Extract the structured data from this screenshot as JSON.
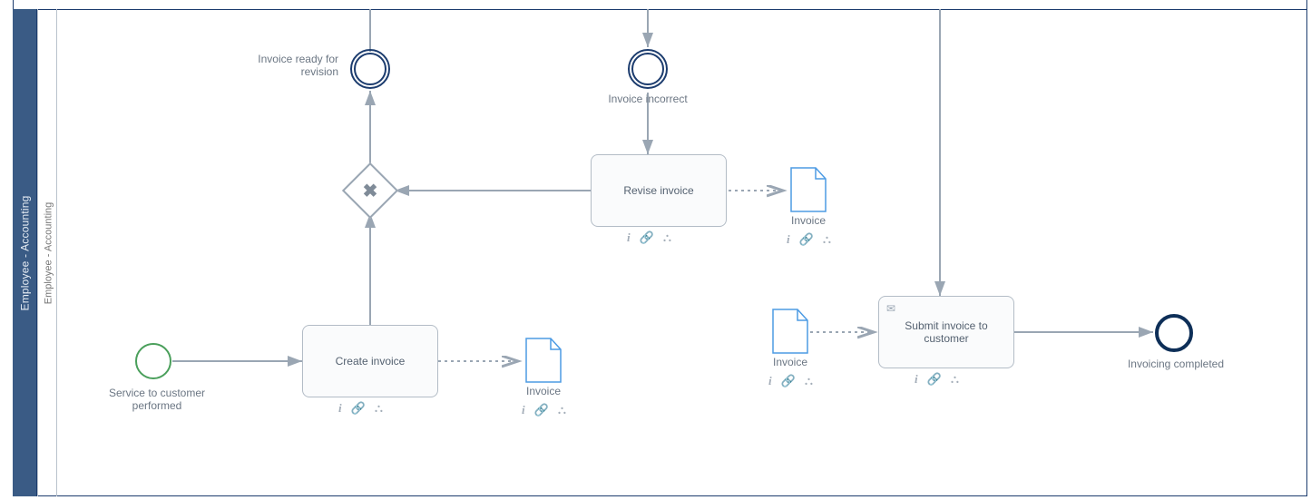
{
  "pool": {
    "label": "Employee - Accounting"
  },
  "lane": {
    "label": "Employee - Accounting"
  },
  "events": {
    "start": {
      "label": "Service to customer performed"
    },
    "readyForRevision": {
      "label": "Invoice ready for revision"
    },
    "invoiceIncorrect": {
      "label": "Invoice incorrect"
    },
    "end": {
      "label": "Invoicing completed"
    }
  },
  "tasks": {
    "create": {
      "label": "Create invoice"
    },
    "revise": {
      "label": "Revise invoice"
    },
    "submit": {
      "label": "Submit invoice to customer"
    }
  },
  "dataObjects": {
    "afterCreate": {
      "label": "Invoice"
    },
    "afterRevise": {
      "label": "Invoice"
    },
    "beforeSubmit": {
      "label": "Invoice"
    }
  },
  "icons": {
    "info": "i",
    "attach": "📎",
    "org": "👥"
  },
  "colors": {
    "poolFill": "#3a5b85",
    "border": "#1c3c6e",
    "taskBorder": "#b3bcc6",
    "startEvent": "#4a9f5b",
    "endEvent": "#0e2f58",
    "dataObject": "#4d9be4",
    "edge": "#9aa6b3"
  },
  "diagram_data": {
    "type": "BPMN",
    "pool": "Employee - Accounting",
    "lanes": [
      "Employee - Accounting"
    ],
    "elements": [
      {
        "id": "start",
        "type": "startEvent",
        "label": "Service to customer performed"
      },
      {
        "id": "create",
        "type": "task",
        "label": "Create invoice"
      },
      {
        "id": "do1",
        "type": "dataObject",
        "label": "Invoice"
      },
      {
        "id": "gw1",
        "type": "exclusiveGateway"
      },
      {
        "id": "ready",
        "type": "intermediateThrowEvent",
        "label": "Invoice ready for revision"
      },
      {
        "id": "incorrect",
        "type": "intermediateCatchEvent",
        "label": "Invoice incorrect"
      },
      {
        "id": "revise",
        "type": "task",
        "label": "Revise invoice"
      },
      {
        "id": "do2",
        "type": "dataObject",
        "label": "Invoice"
      },
      {
        "id": "do3",
        "type": "dataObject",
        "label": "Invoice"
      },
      {
        "id": "submit",
        "type": "sendTask",
        "label": "Submit invoice to customer"
      },
      {
        "id": "end",
        "type": "endEvent",
        "label": "Invoicing completed"
      }
    ],
    "sequenceFlows": [
      {
        "from": "start",
        "to": "create"
      },
      {
        "from": "create",
        "to": "gw1"
      },
      {
        "from": "gw1",
        "to": "ready"
      },
      {
        "from": "incorrect",
        "to": "revise"
      },
      {
        "from": "revise",
        "to": "gw1"
      },
      {
        "from": "submit",
        "to": "end"
      },
      {
        "from": "(offscreen-above)",
        "to": "gw1"
      },
      {
        "from": "(offscreen-above)",
        "to": "incorrect"
      },
      {
        "from": "(offscreen-above)",
        "to": "submit"
      }
    ],
    "dataAssociations": [
      {
        "from": "create",
        "to": "do1"
      },
      {
        "from": "revise",
        "to": "do2"
      },
      {
        "from": "do3",
        "to": "submit"
      }
    ]
  }
}
